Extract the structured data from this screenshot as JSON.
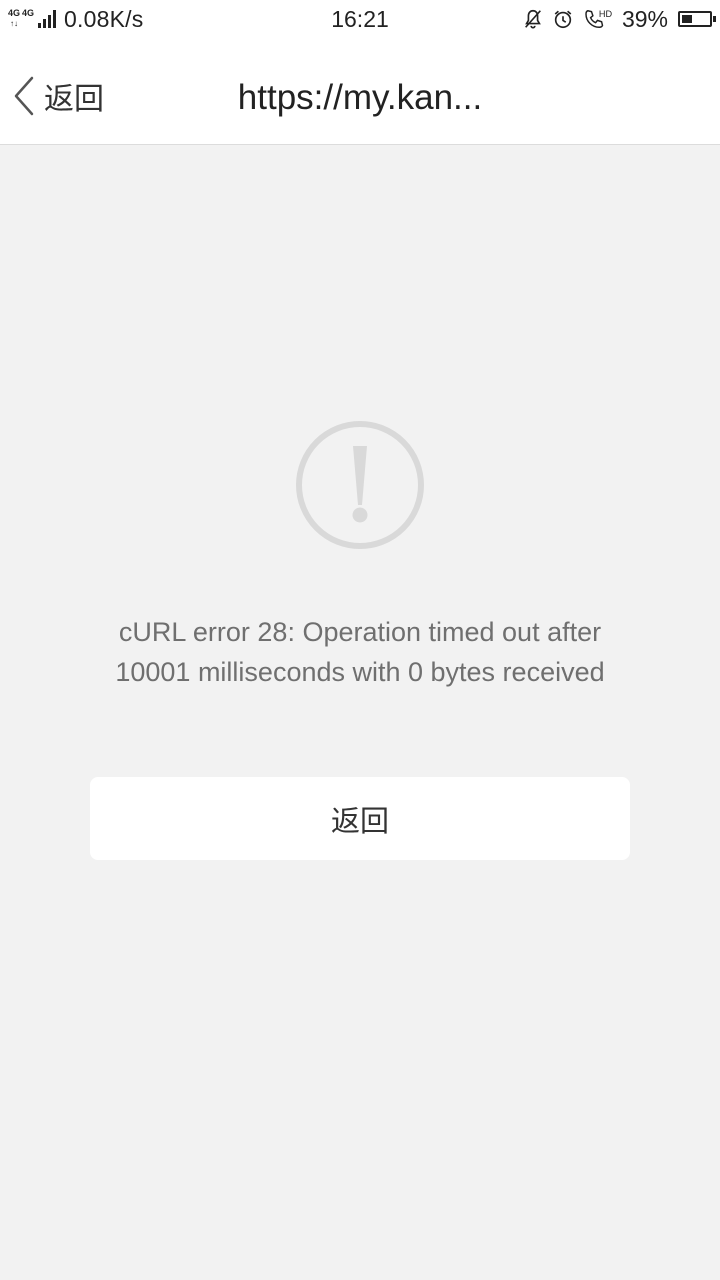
{
  "status_bar": {
    "net_tag_1": "4G",
    "net_tag_2": "4G",
    "net_arrows": "↑↓",
    "net_speed": "0.08K/s",
    "time": "16:21",
    "hd_label": "HD",
    "battery_percent": "39%",
    "battery_level": 0.39
  },
  "nav": {
    "back_label": "返回",
    "title": "https://my.kan..."
  },
  "error": {
    "message": "cURL error 28: Operation timed out after 10001 milliseconds with 0 bytes received",
    "button_label": "返回"
  },
  "colors": {
    "background": "#f2f2f2",
    "icon_gray": "#d9d9d9",
    "message_gray": "#6f6f6f"
  }
}
